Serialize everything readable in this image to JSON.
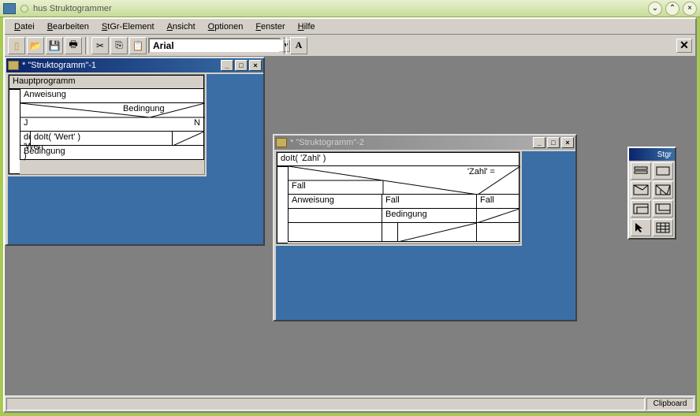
{
  "outer": {
    "title": "hus Struktogrammer"
  },
  "menu": {
    "file": "Datei",
    "edit": "Bearbeiten",
    "element": "StGr-Element",
    "view": "Ansicht",
    "options": "Optionen",
    "window": "Fenster",
    "help": "Hilfe"
  },
  "toolbar": {
    "font": "Arial",
    "font_button": "A"
  },
  "win1": {
    "title": "* \"Struktogramm\"-1",
    "d": {
      "main": "Hauptprogramm",
      "anweisung": "Anweisung",
      "bedingung": "Bedingung",
      "j": "J",
      "n": "N",
      "doit": "doIt( 'Wert' )",
      "bedingung2": "Bedingung"
    }
  },
  "win2": {
    "title": "* \"Struktogramm\"-2",
    "d": {
      "doit": "doIt( 'Zahl' )",
      "zahl": "'Zahl' =",
      "fall1": "Fall",
      "fall2": "Fall",
      "fall3": "Fall",
      "anweisung": "Anweisung",
      "bedingung": "Bedingung"
    }
  },
  "palette": {
    "title": "Stgr"
  },
  "status": {
    "clipboard": "Clipboard"
  }
}
